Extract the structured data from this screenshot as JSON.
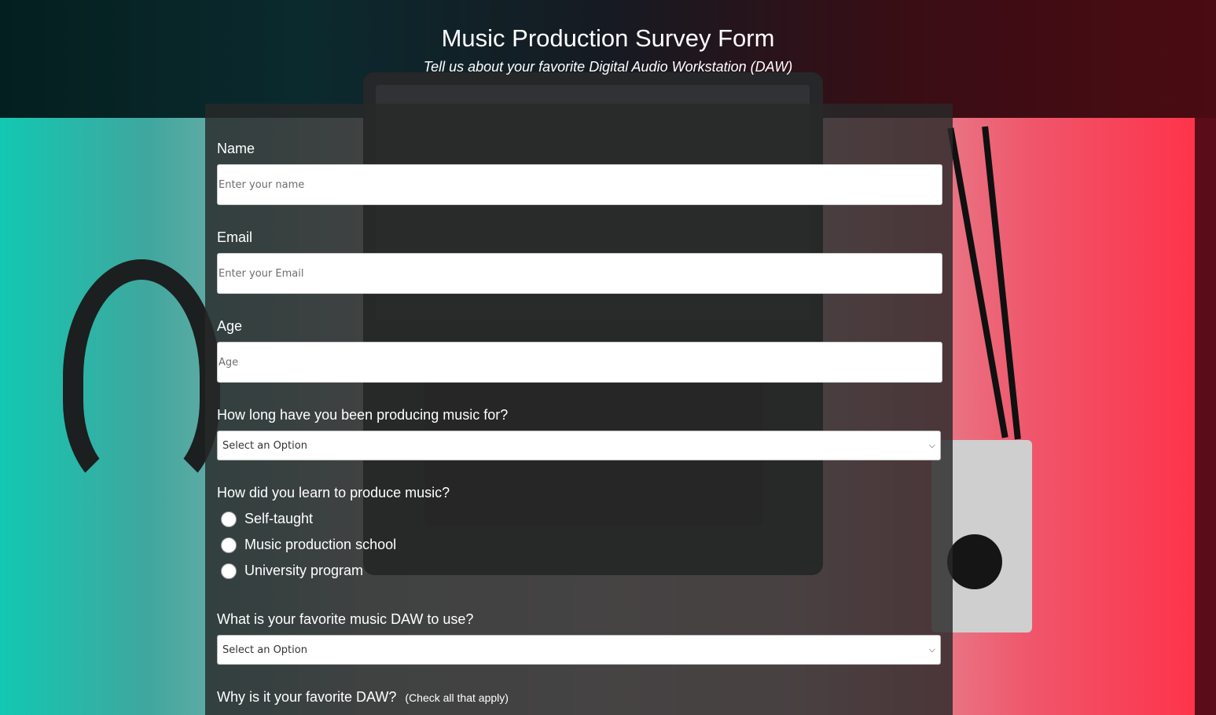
{
  "header": {
    "title": "Music Production Survey Form",
    "subtitle": "Tell us about your favorite Digital Audio Workstation (DAW)"
  },
  "form": {
    "name": {
      "label": "Name",
      "placeholder": "Enter your name"
    },
    "email": {
      "label": "Email",
      "placeholder": "Enter your Email"
    },
    "age": {
      "label": "Age",
      "placeholder": "Age"
    },
    "experience": {
      "label": "How long have you been producing music for?",
      "selected": "Select an Option"
    },
    "learn": {
      "label": "How did you learn to produce music?",
      "options": [
        "Self-taught",
        "Music production school",
        "University program"
      ]
    },
    "daw": {
      "label": "What is your favorite music DAW to use?",
      "selected": "Select an Option"
    },
    "why": {
      "label": "Why is it your favorite DAW?",
      "hint": "(Check all that apply)"
    }
  },
  "icons": {
    "select_arrow": "chevron-down-icon"
  }
}
